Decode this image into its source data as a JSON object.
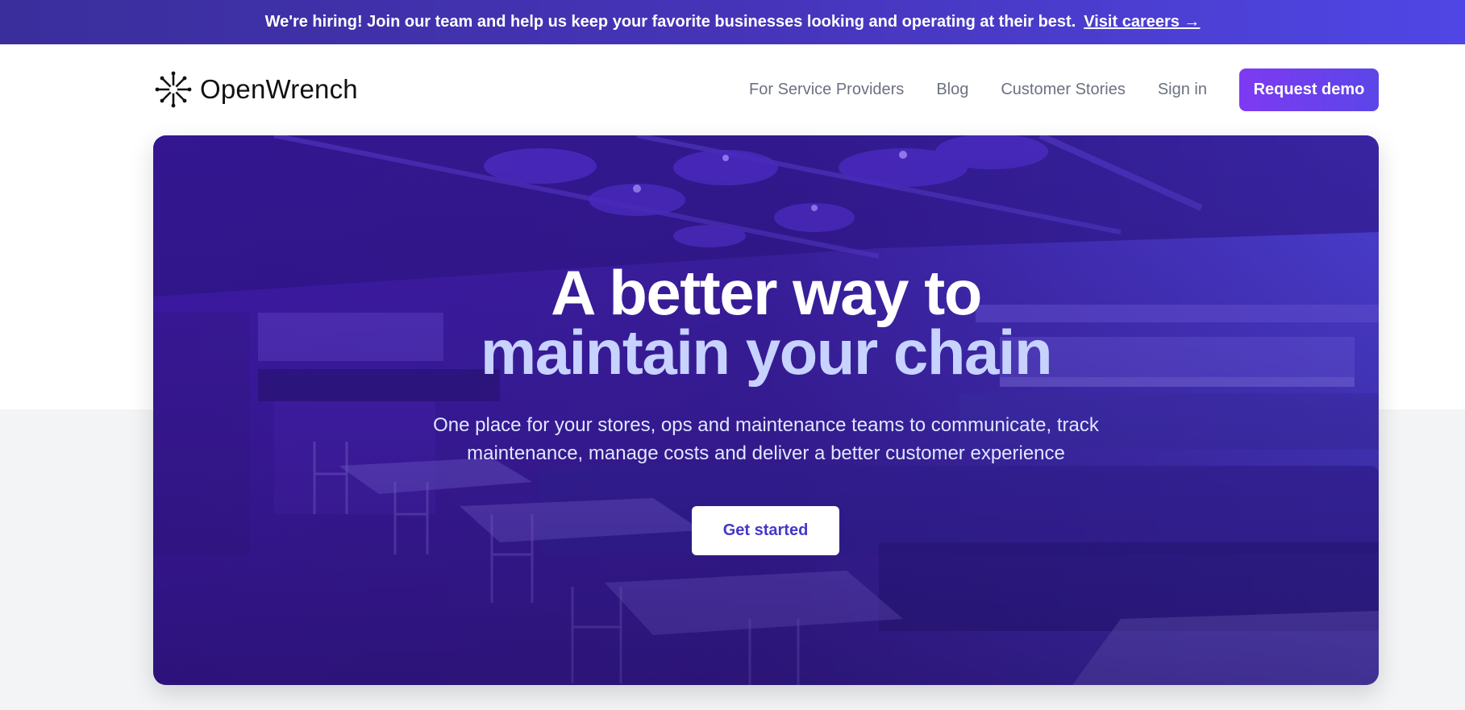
{
  "banner": {
    "text": "We're hiring! Join our team and help us keep your favorite businesses looking and operating at their best.",
    "link_label": "Visit careers →"
  },
  "header": {
    "logo_text": "OpenWrench",
    "logo_icon": "wrench-burst-icon",
    "nav": [
      {
        "label": "For Service Providers"
      },
      {
        "label": "Blog"
      },
      {
        "label": "Customer Stories"
      },
      {
        "label": "Sign in"
      }
    ],
    "cta_label": "Request demo"
  },
  "hero": {
    "title_line1": "A better way to",
    "title_line2": "maintain your chain",
    "subtitle_line1": "One place for your stores, ops and maintenance teams to communicate, track",
    "subtitle_line2": "maintenance, manage costs and deliver a better customer experience",
    "cta_label": "Get started",
    "image_subject": "restaurant interior with purple overlay"
  },
  "colors": {
    "banner_start": "#3a2e9c",
    "banner_end": "#4f46e5",
    "cta_start": "#7e3af2",
    "cta_end": "#5b46e8",
    "overlay": "#3b1a9e",
    "title_accent": "#c7d2fe",
    "nav_text": "#6b7280"
  }
}
